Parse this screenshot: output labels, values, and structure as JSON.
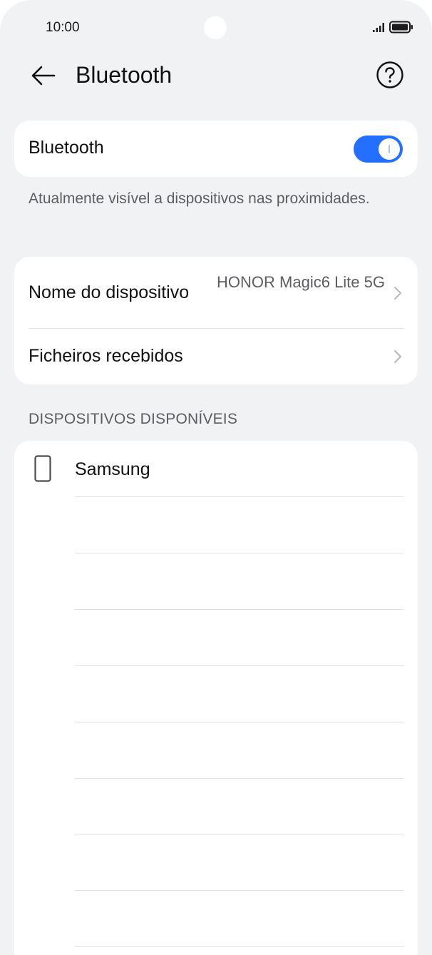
{
  "status_bar": {
    "time": "10:00",
    "signal_icon": "signal-icon",
    "battery_icon": "battery-icon"
  },
  "header": {
    "back_icon": "back-arrow-icon",
    "title": "Bluetooth",
    "help_icon": "help-icon"
  },
  "bluetooth_card": {
    "label": "Bluetooth",
    "toggle_on": true,
    "accent_color": "#256fff"
  },
  "visibility_note": "Atualmente visível a dispositivos nas proximidades.",
  "info_card": {
    "device_name_label": "Nome do dispositivo",
    "device_name_value": "HONOR Magic6 Lite 5G",
    "received_files_label": "Ficheiros recebidos"
  },
  "available_devices": {
    "header": "DISPOSITIVOS DISPONÍVEIS",
    "devices": [
      {
        "name": "Samsung",
        "icon": "phone-icon"
      }
    ]
  }
}
